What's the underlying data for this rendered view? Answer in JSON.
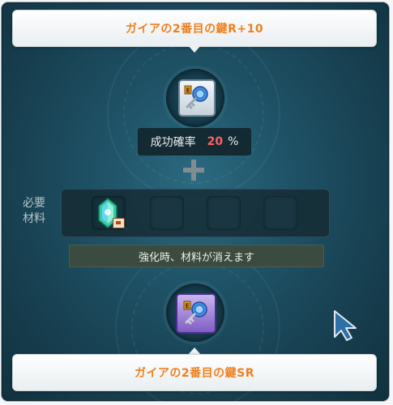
{
  "target_item": {
    "name": "ガイアの2番目の鍵R+10",
    "icon": "gaia-key-rare-icon"
  },
  "success_rate": {
    "label": "成功確率",
    "value": "20",
    "unit": "%"
  },
  "materials": {
    "label": "必要材料",
    "slots": [
      {
        "icon": "green-crystal-icon",
        "filled": true
      },
      {
        "filled": false
      },
      {
        "filled": false
      },
      {
        "filled": false
      }
    ],
    "warning": "強化時、材料が消えます"
  },
  "result_item": {
    "name": "ガイアの2番目の鍵SR",
    "icon": "gaia-key-superrare-icon"
  },
  "colors": {
    "item_name": "#f0801e",
    "rate_value": "#ff6060",
    "panel_background": "#1f5266"
  }
}
